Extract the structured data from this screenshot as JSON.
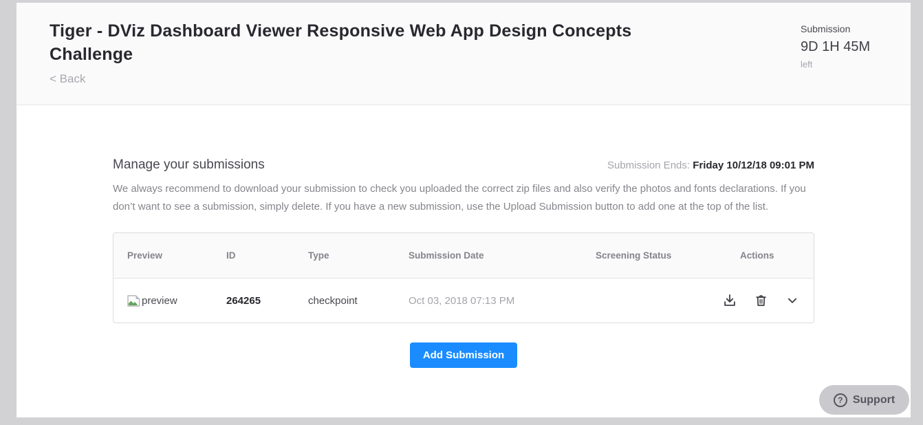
{
  "header": {
    "title": "Tiger - DViz Dashboard Viewer Responsive Web App Design Concepts Challenge",
    "back_label": "< Back",
    "countdown": {
      "label": "Submission",
      "time": "9D 1H 45M",
      "suffix": "left"
    }
  },
  "main": {
    "section_title": "Manage your submissions",
    "submission_ends_label": "Submission Ends:",
    "submission_ends_value": "Friday 10/12/18 09:01 PM",
    "description": "We always recommend to download your submission to check you uploaded the correct zip files and also verify the photos and fonts declarations. If you don’t want to see a submission, simply delete. If you have a new submission, use the Upload Submission button to add one at the top of the list.",
    "table": {
      "columns": [
        "Preview",
        "ID",
        "Type",
        "Submission Date",
        "Screening Status",
        "Actions"
      ],
      "rows": [
        {
          "preview_alt": "preview",
          "id": "264265",
          "type": "checkpoint",
          "date": "Oct 03, 2018 07:13 PM",
          "screening_status": "",
          "action_icons": [
            "download-icon",
            "trash-icon",
            "chevron-down-icon"
          ]
        }
      ]
    },
    "add_button_label": "Add Submission"
  },
  "support": {
    "label": "Support",
    "icon": "question-mark-icon"
  },
  "colors": {
    "accent_blue": "#1a8cff",
    "frame_gray": "#d2d2d4",
    "header_bg": "#fafafb",
    "table_border": "#dcdcdf"
  }
}
